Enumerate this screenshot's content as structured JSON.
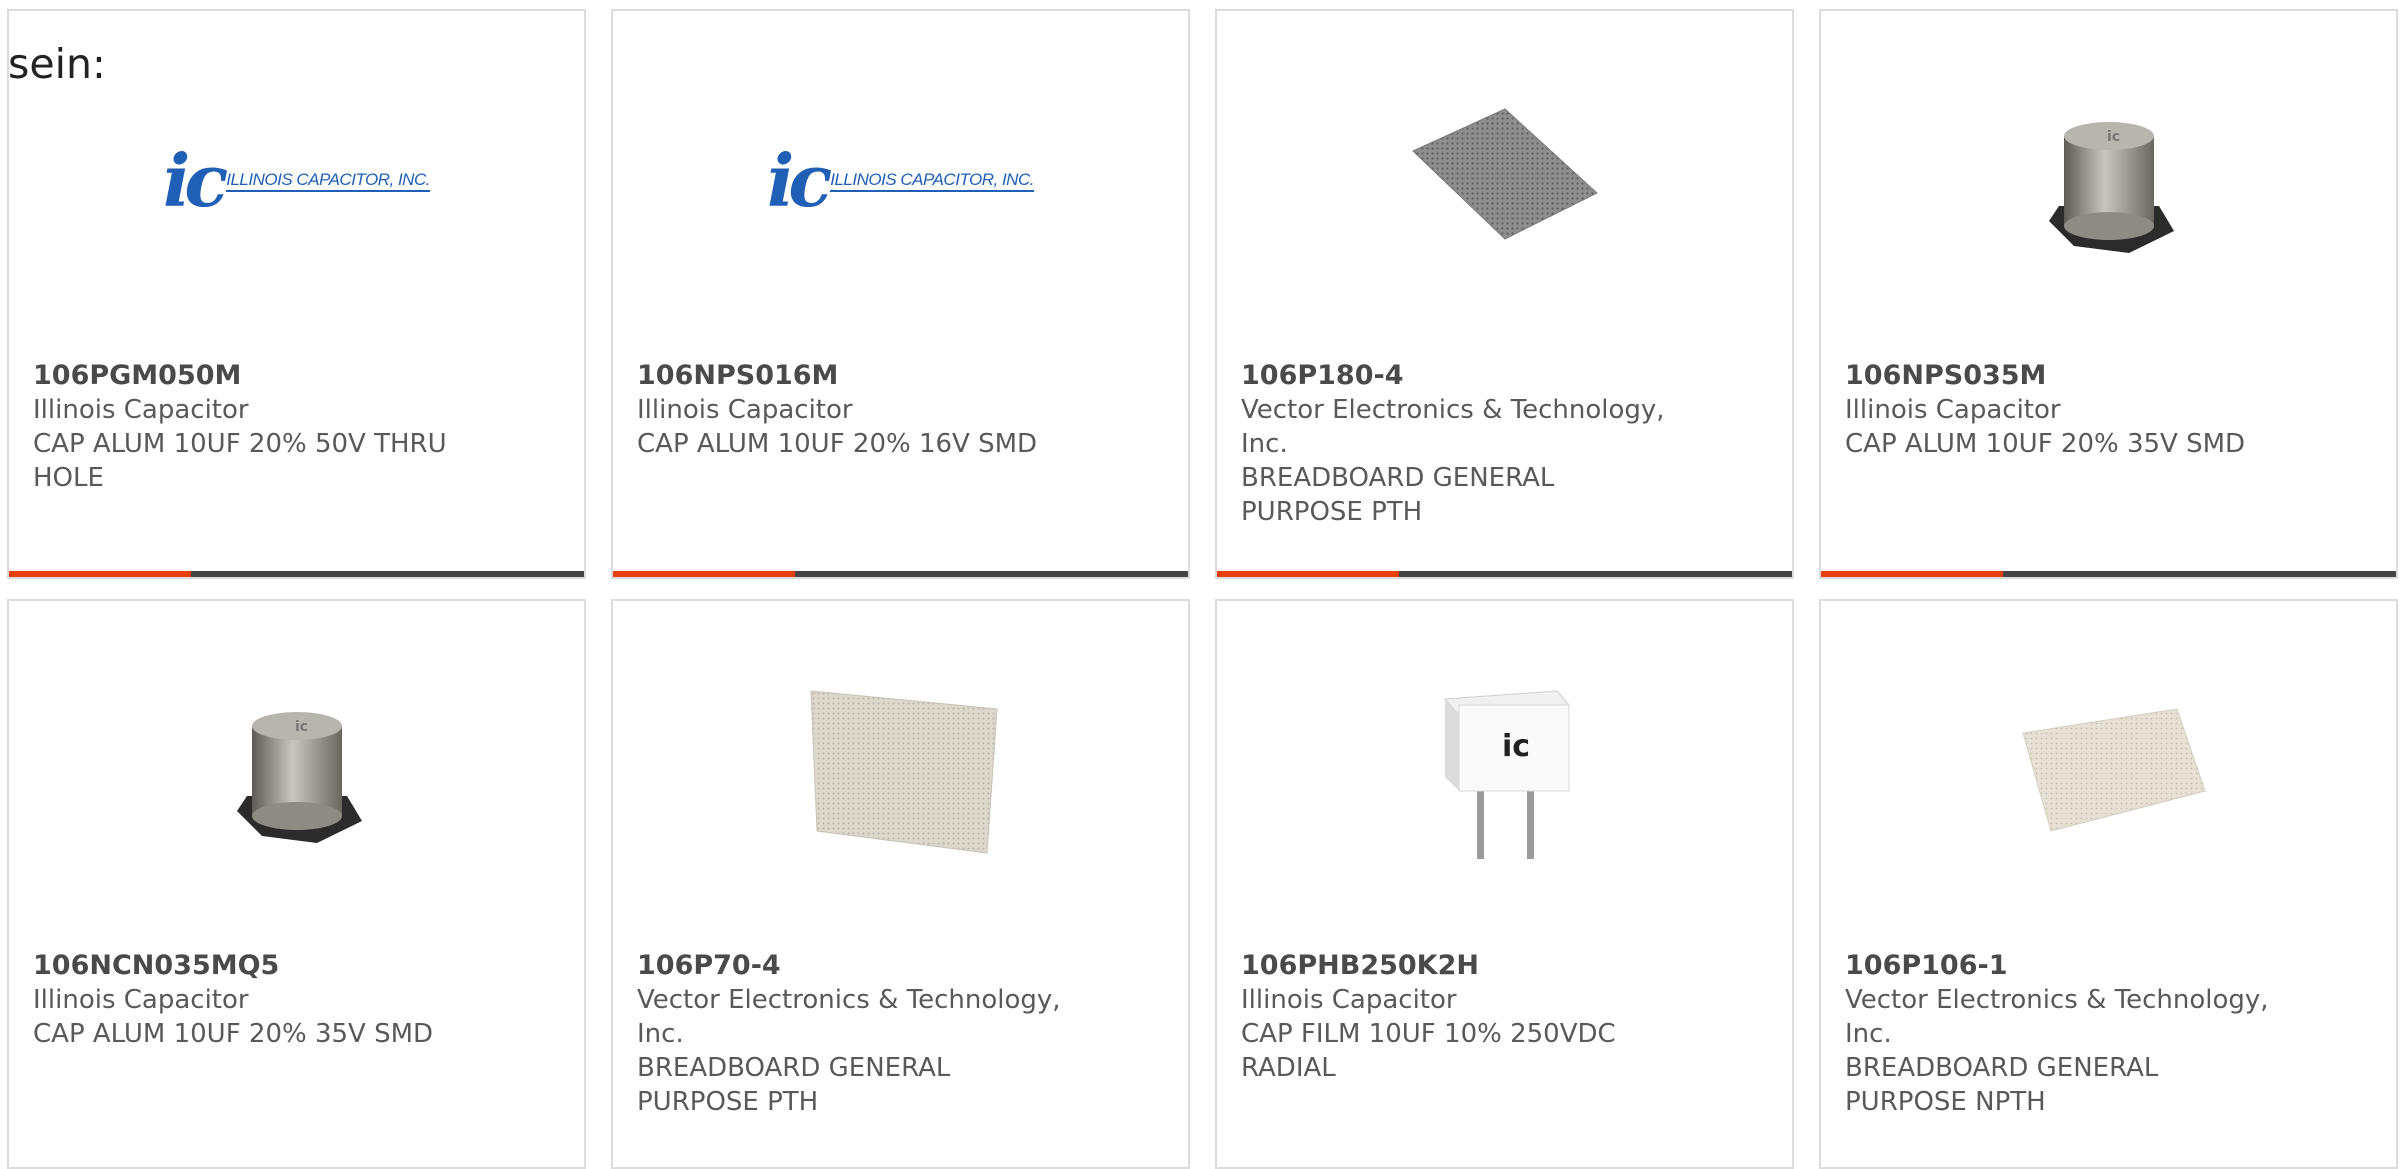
{
  "page": {
    "label": "sein:"
  },
  "products": [
    {
      "part": "106PGM050M",
      "manufacturer": "Illinois Capacitor",
      "desc1": "CAP ALUM 10UF 20% 50V THRU",
      "desc2": "HOLE",
      "image": "ic-logo",
      "logo_mark": "ic",
      "logo_text": "ILLINOIS CAPACITOR, INC."
    },
    {
      "part": "106NPS016M",
      "manufacturer": "Illinois Capacitor",
      "desc1": "CAP ALUM 10UF 20% 16V SMD",
      "desc2": "",
      "image": "ic-logo",
      "logo_mark": "ic",
      "logo_text": "ILLINOIS CAPACITOR, INC."
    },
    {
      "part": "106P180-4",
      "manufacturer": "Vector Electronics & Technology,",
      "manufacturer2": "Inc.",
      "desc1": "BREADBOARD GENERAL",
      "desc2": "PURPOSE PTH",
      "image": "breadboard-dark"
    },
    {
      "part": "106NPS035M",
      "manufacturer": "Illinois Capacitor",
      "desc1": "CAP ALUM 10UF 20% 35V SMD",
      "desc2": "",
      "image": "smd-capacitor"
    },
    {
      "part": "106NCN035MQ5",
      "manufacturer": "Illinois Capacitor",
      "desc1": "CAP ALUM 10UF 20% 35V SMD",
      "desc2": "",
      "image": "smd-capacitor"
    },
    {
      "part": "106P70-4",
      "manufacturer": "Vector Electronics & Technology,",
      "manufacturer2": "Inc.",
      "desc1": "BREADBOARD GENERAL",
      "desc2": "PURPOSE PTH",
      "image": "breadboard-light"
    },
    {
      "part": "106PHB250K2H",
      "manufacturer": "Illinois Capacitor",
      "desc1": "CAP FILM 10UF 10% 250VDC",
      "desc2": "RADIAL",
      "image": "film-capacitor",
      "logo_mark": "ic"
    },
    {
      "part": "106P106-1",
      "manufacturer": "Vector Electronics & Technology,",
      "manufacturer2": "Inc.",
      "desc1": "BREADBOARD GENERAL",
      "desc2": "PURPOSE NPTH",
      "image": "breadboard-tile"
    }
  ],
  "colors": {
    "accent": "#e8400c",
    "bar": "#444444",
    "logo": "#1f5fb6"
  }
}
